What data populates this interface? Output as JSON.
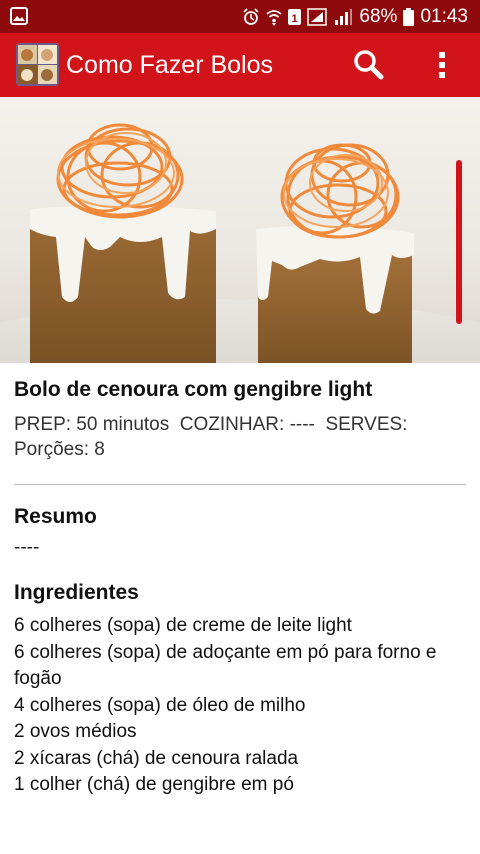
{
  "status_bar": {
    "battery_percent": "68%",
    "time": "01:43"
  },
  "app_bar": {
    "title": "Como Fazer Bolos",
    "icons": [
      "app-logo",
      "search-icon",
      "more-vert-icon"
    ]
  },
  "recipe": {
    "title": "Bolo de cenoura com gengibre light",
    "meta_line_1": "PREP: 50 minutos  COZINHAR: ----  SERVES:",
    "meta_line_2": "Porções: 8",
    "summary_heading": "Resumo",
    "summary_text": "----",
    "ingredients_heading": "Ingredientes",
    "ingredients": [
      "6 colheres (sopa) de creme de leite light",
      "6 colheres (sopa) de adoçante em pó para forno e fogão",
      "4 colheres (sopa) de óleo de milho",
      "2 ovos médios",
      "2 xícaras (chá) de cenoura ralada",
      "1 colher (chá) de gengibre em pó"
    ]
  },
  "colors": {
    "status_bar": "#8f0a0d",
    "app_bar": "#d0141a",
    "accent": "#d0141a"
  }
}
